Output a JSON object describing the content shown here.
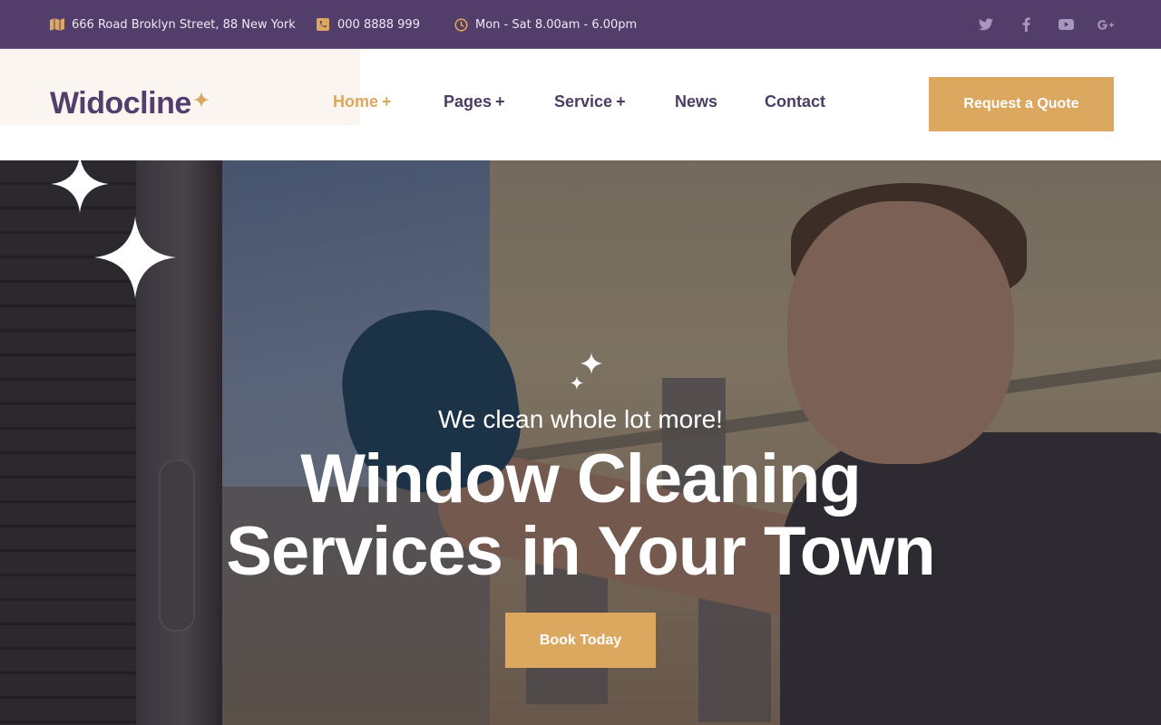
{
  "colors": {
    "topbar_bg": "#533d6b",
    "accent": "#dca75e",
    "brand": "#533d6b"
  },
  "topbar": {
    "address": "666 Road Broklyn Street, 88 New York",
    "phone": "000 8888 999",
    "hours": "Mon - Sat 8.00am - 6.00pm",
    "icons": {
      "address": "map-icon",
      "phone": "phone-icon",
      "hours": "clock-icon"
    },
    "socials": [
      {
        "name": "twitter-icon",
        "glyph": "🐦"
      },
      {
        "name": "facebook-icon",
        "glyph": "f"
      },
      {
        "name": "youtube-icon",
        "glyph": "▶"
      },
      {
        "name": "google-plus-icon",
        "glyph": "G+"
      }
    ]
  },
  "header": {
    "logo": "Widocline",
    "nav": [
      {
        "label": "Home",
        "has_submenu": true,
        "active": true
      },
      {
        "label": "Pages",
        "has_submenu": true,
        "active": false
      },
      {
        "label": "Service",
        "has_submenu": true,
        "active": false
      },
      {
        "label": "News",
        "has_submenu": false,
        "active": false
      },
      {
        "label": "Contact",
        "has_submenu": false,
        "active": false
      }
    ],
    "plus": "+",
    "quote_button": "Request a Quote"
  },
  "hero": {
    "subtitle": "We clean whole lot more!",
    "title_line1": "Window Cleaning",
    "title_line2": "Services in Your Town",
    "button": "Book Today"
  }
}
